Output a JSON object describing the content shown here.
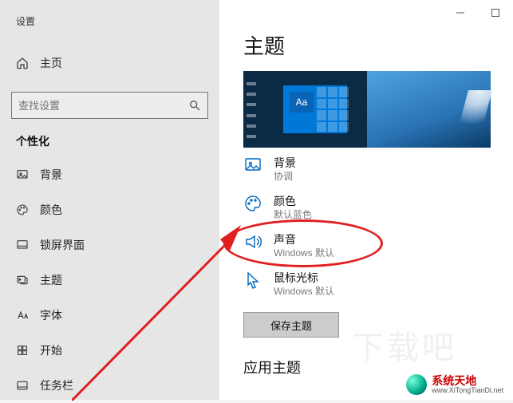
{
  "sidebar": {
    "app_label": "设置",
    "home_label": "主页",
    "search_placeholder": "查找设置",
    "category": "个性化",
    "items": [
      {
        "label": "背景"
      },
      {
        "label": "颜色"
      },
      {
        "label": "锁屏界面"
      },
      {
        "label": "主题"
      },
      {
        "label": "字体"
      },
      {
        "label": "开始"
      },
      {
        "label": "任务栏"
      }
    ]
  },
  "main": {
    "page_title": "主题",
    "preview_tile_text": "Aa",
    "settings": [
      {
        "title": "背景",
        "subtitle": "协调"
      },
      {
        "title": "颜色",
        "subtitle": "默认蓝色"
      },
      {
        "title": "声音",
        "subtitle": "Windows 默认"
      },
      {
        "title": "鼠标光标",
        "subtitle": "Windows 默认"
      }
    ],
    "save_button": "保存主题",
    "apply_section": "应用主题"
  },
  "watermark": {
    "brand": "系统天地",
    "url": "www.XiTongTianDi.net",
    "faint": "下载吧"
  },
  "colors": {
    "accent": "#0067c0",
    "annotation": "#e02020"
  }
}
